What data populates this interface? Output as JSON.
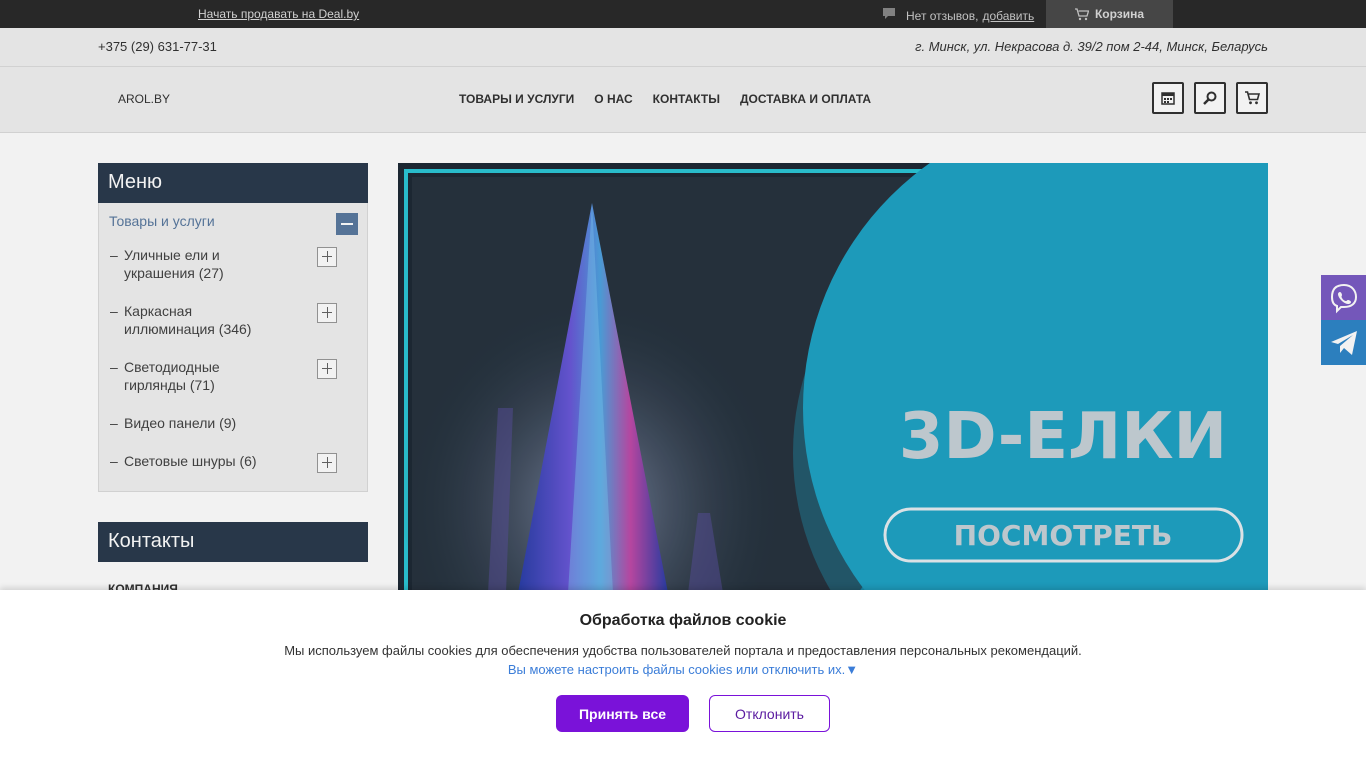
{
  "topbar": {
    "sell_link": "Начать продавать на Deal.by",
    "reviews_text": "Нет отзывов,",
    "reviews_add": "добавить",
    "cart_label": "Корзина"
  },
  "info": {
    "phone": "+375 (29) 631-77-31",
    "address": "г. Минск, ул. Некрасова д. 39/2 пом 2-44, Минск, Беларусь"
  },
  "nav": {
    "logo": "AROL.BY",
    "items": [
      "ТОВАРЫ И УСЛУГИ",
      "О НАС",
      "КОНТАКТЫ",
      "ДОСТАВКА И ОПЛАТА"
    ],
    "tools": [
      "calendar-icon",
      "search-icon",
      "cart-icon"
    ]
  },
  "sidebar": {
    "menu_title": "Меню",
    "root": "Товары и услуги",
    "items": [
      {
        "line1": "Уличные ели и",
        "line2": "украшения",
        "count": "(27)"
      },
      {
        "line1": "Каркасная",
        "line2": "иллюминация",
        "count": "(346)"
      },
      {
        "line1": "Светодиодные",
        "line2": "гирлянды",
        "count": "(71)"
      },
      {
        "line1": "Видео панели",
        "line2": "",
        "count": "(9)"
      },
      {
        "line1": "Световые шнуры",
        "line2": "",
        "count": "(6)"
      }
    ],
    "contacts_title": "Контакты",
    "company": "КОМПАНИЯ"
  },
  "banner": {
    "headline": "3D-ЕЛКИ",
    "cta": "ПОСМОТРЕТЬ",
    "accent": "#1fa3c4"
  },
  "cookie": {
    "title": "Обработка файлов cookie",
    "text": "Мы используем файлы cookies для обеспечения удобства пользователей портала и предоставления персональных рекомендаций.",
    "link": "Вы можете настроить файлы cookies или отключить их.▼",
    "accept": "Принять все",
    "decline": "Отклонить",
    "accent": "#7a12d9"
  },
  "social": {
    "viber_color": "#7b5cc4",
    "telegram_color": "#2f86c9"
  }
}
